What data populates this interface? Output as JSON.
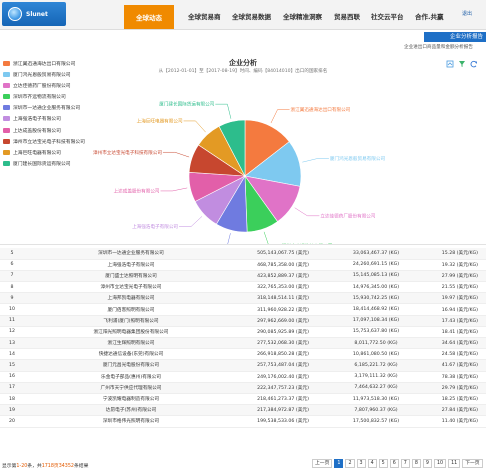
{
  "header": {
    "logo_text": "Slunet",
    "nav_active": "全球动态",
    "nav": [
      "全球贸易商",
      "全球贸易数据",
      "全球精准洞察",
      "贸易西联",
      "社交云平台",
      "合作.共赢"
    ],
    "exit": "退出"
  },
  "subheader": {
    "tab": "企业分析报告",
    "breadcrumb": "企业进出口商品量和金额分析报告"
  },
  "chart_data": {
    "type": "pie",
    "title": "企业分析",
    "subtitle": "从【2012-01-01】至【2017-08-19】时间、编码【84014010】出口的国家排名",
    "colors": [
      "#f47a3f",
      "#7ec9f0",
      "#e073c7",
      "#3bcf5b",
      "#6f7be0",
      "#c18de0",
      "#e25fa9",
      "#c7472f",
      "#e39a24",
      "#2dbd8c"
    ],
    "categories": [
      "浙江翼迅通海达出口有限公司",
      "厦门鸿光恩般贸易有限公司",
      "立达佳德药厂股份有限公司",
      "深圳市齐远物流有限公司",
      "深圳市一达通企业服务有限公司",
      "上海强浩电子有限公司",
      "上达成盖股份有限公司",
      "漳州市立达宝光电子科技有限公司",
      "上海巨旺电器有限公司",
      "厦门建长国际货运有限公司"
    ],
    "values": [
      505.14,
      468.79,
      423.85,
      322.77,
      318.15,
      311.96,
      297.96,
      290.09,
      277.53,
      266.92
    ],
    "unit": "美元"
  },
  "table": {
    "rows": [
      {
        "idx": "5",
        "name": "深圳市一达通企业服务有限公司",
        "amount": "505,143,067.75 (美元)",
        "weight": "33,063,467.37 (KG)",
        "pct": "15.28 (美元/KG)"
      },
      {
        "idx": "6",
        "name": "上海强浩电子有限公司",
        "amount": "468,785,358.00 (美元)",
        "weight": "24,260,691.15 (KG)",
        "pct": "19.32 (美元/KG)"
      },
      {
        "idx": "7",
        "name": "厦门盛士达照明有限公司",
        "amount": "423,852,889.37 (美元)",
        "weight": "15,145,085.13 (KG)",
        "pct": "27.99 (美元/KG)"
      },
      {
        "idx": "8",
        "name": "漳州市立达宝光电子有限公司",
        "amount": "322,765,353.00 (美元)",
        "weight": "14,976,345.00 (KG)",
        "pct": "21.55 (美元/KG)"
      },
      {
        "idx": "9",
        "name": "上海邦凯电器有限公司",
        "amount": "318,148,514.11 (美元)",
        "weight": "15,930,742.25 (KG)",
        "pct": "19.97 (美元/KG)"
      },
      {
        "idx": "10",
        "name": "厦门佰客照明有限公司",
        "amount": "311,960,928.22 (美元)",
        "weight": "18,414,468.92 (KG)",
        "pct": "16.94 (美元/KG)"
      },
      {
        "idx": "11",
        "name": "飞利浦(厦门)照明有限公司",
        "amount": "297,962,669.00 (美元)",
        "weight": "17,097,108.34 (KG)",
        "pct": "17.43 (美元/KG)"
      },
      {
        "idx": "12",
        "name": "浙江阳光照明电器集团股份有限公司",
        "amount": "290,085,925.89 (美元)",
        "weight": "15,753,637.80 (KG)",
        "pct": "18.41 (美元/KG)"
      },
      {
        "idx": "13",
        "name": "浙江生辉照明有限公司",
        "amount": "277,532,068.30 (美元)",
        "weight": "8,011,772.50 (KG)",
        "pct": "34.64 (美元/KG)"
      },
      {
        "idx": "14",
        "name": "快捷达通信设备(东莞)有限公司",
        "amount": "266,918,850.28 (美元)",
        "weight": "10,861,080.50 (KG)",
        "pct": "24.58 (美元/KG)"
      },
      {
        "idx": "15",
        "name": "厦门元昌光电股份有限公司",
        "amount": "257,753,487.04 (美元)",
        "weight": "6,185,221.72 (KG)",
        "pct": "41.67 (美元/KG)"
      },
      {
        "idx": "16",
        "name": "乐金电子部品(惠州)有限公司",
        "amount": "249,176,002.40 (美元)",
        "weight": "3,179,111.32 (KG)",
        "pct": "78.38 (美元/KG)"
      },
      {
        "idx": "17",
        "name": "广州市天宁供应代理有限公司",
        "amount": "222,347,757.23 (美元)",
        "weight": "7,464,632.27 (KG)",
        "pct": "29.79 (美元/KG)"
      },
      {
        "idx": "18",
        "name": "宁波凯耀电器制造有限公司",
        "amount": "218,461,273.37 (美元)",
        "weight": "11,973,518.30 (KG)",
        "pct": "18.25 (美元/KG)"
      },
      {
        "idx": "19",
        "name": "达昂电子(苏州)有限公司",
        "amount": "217,384,972.87 (美元)",
        "weight": "7,807,960.37 (KG)",
        "pct": "27.84 (美元/KG)"
      },
      {
        "idx": "20",
        "name": "深圳市格伟光照明有限公司",
        "amount": "199,538,533.06 (美元)",
        "weight": "17,500,832.57 (KG)",
        "pct": "11.40 (美元/KG)"
      }
    ]
  },
  "footer": {
    "info_prefix": "显示第",
    "info_range": "1-20",
    "info_mid": "条，共",
    "info_total": "1718页34352",
    "info_suffix": "条结果",
    "pager": [
      "上一页",
      "1",
      "2",
      "3",
      "4",
      "5",
      "6",
      "7",
      "8",
      "9",
      "10",
      "11",
      "下一页"
    ],
    "current_page": "1"
  }
}
